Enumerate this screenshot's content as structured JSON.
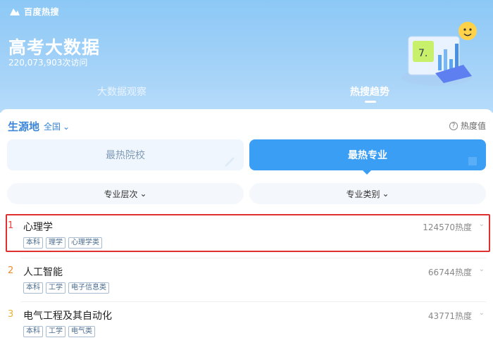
{
  "brand": {
    "name": "百度热搜"
  },
  "page": {
    "title": "高考大数据",
    "visits": "220,073,903次访问"
  },
  "tabs": [
    {
      "label": "大数据观察",
      "active": false
    },
    {
      "label": "热搜趋势",
      "active": true
    }
  ],
  "origin": {
    "label": "生源地",
    "value": "全国"
  },
  "heat_help": {
    "label": "热度值"
  },
  "segments": [
    {
      "label": "最热院校",
      "active": false
    },
    {
      "label": "最热专业",
      "active": true
    }
  ],
  "filters": [
    {
      "label": "专业层次"
    },
    {
      "label": "专业类别"
    }
  ],
  "majors": [
    {
      "rank": "1",
      "name": "心理学",
      "heat": "124570热度",
      "tags": [
        "本科",
        "理学",
        "心理学类"
      ]
    },
    {
      "rank": "2",
      "name": "人工智能",
      "heat": "66744热度",
      "tags": [
        "本科",
        "工学",
        "电子信息类"
      ]
    },
    {
      "rank": "3",
      "name": "电气工程及其自动化",
      "heat": "43771热度",
      "tags": [
        "本科",
        "工学",
        "电气类"
      ]
    }
  ],
  "colors": {
    "accent": "#3b9ef5",
    "header": "#8cc8f6",
    "highlight_box": "#e02f2f"
  }
}
